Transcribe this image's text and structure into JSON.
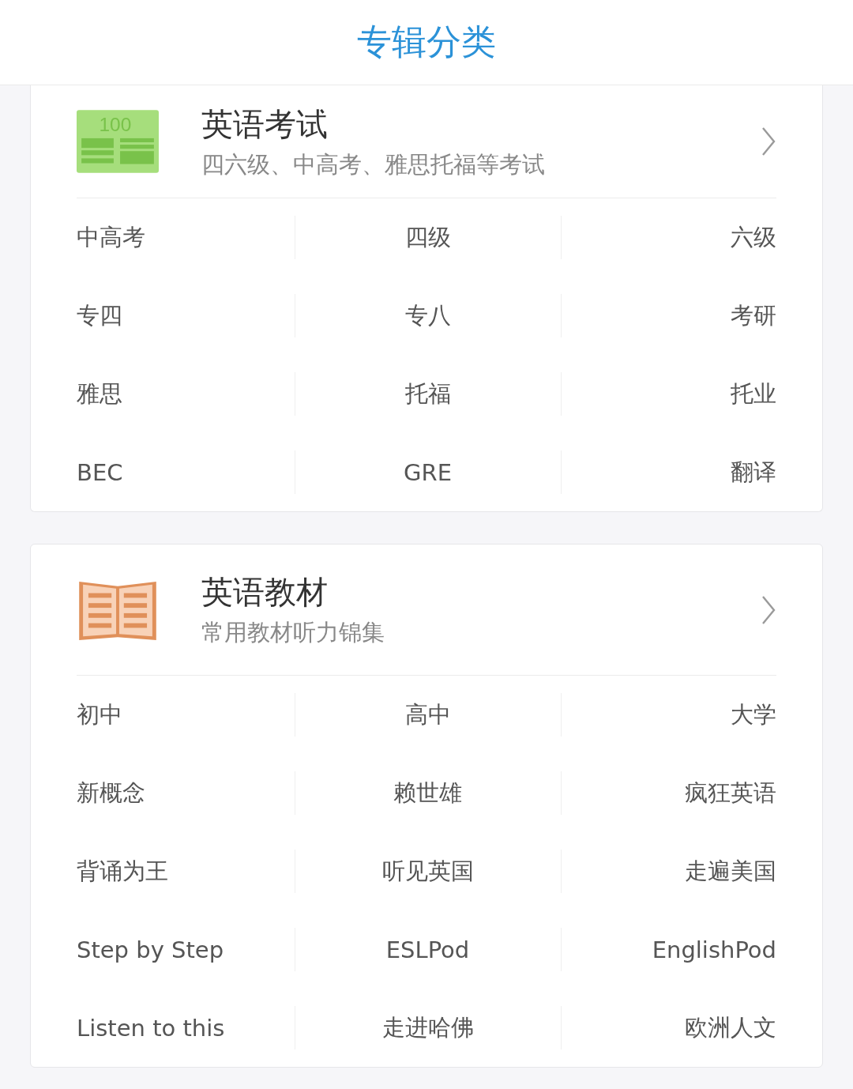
{
  "header": {
    "title": "专辑分类"
  },
  "categories": [
    {
      "icon": {
        "kind": "exam",
        "label": "100"
      },
      "title": "英语考试",
      "subtitle": "四六级、中高考、雅思托福等考试",
      "items": [
        "中高考",
        "四级",
        "六级",
        "专四",
        "专八",
        "考研",
        "雅思",
        "托福",
        "托业",
        "BEC",
        "GRE",
        "翻译"
      ]
    },
    {
      "icon": {
        "kind": "book"
      },
      "title": "英语教材",
      "subtitle": "常用教材听力锦集",
      "items": [
        "初中",
        "高中",
        "大学",
        "新概念",
        "赖世雄",
        "疯狂英语",
        "背诵为王",
        "听见英国",
        "走遍美国",
        "Step by Step",
        "ESLPod",
        "EnglishPod",
        "Listen to this",
        "走进哈佛",
        "欧洲人文"
      ]
    }
  ]
}
